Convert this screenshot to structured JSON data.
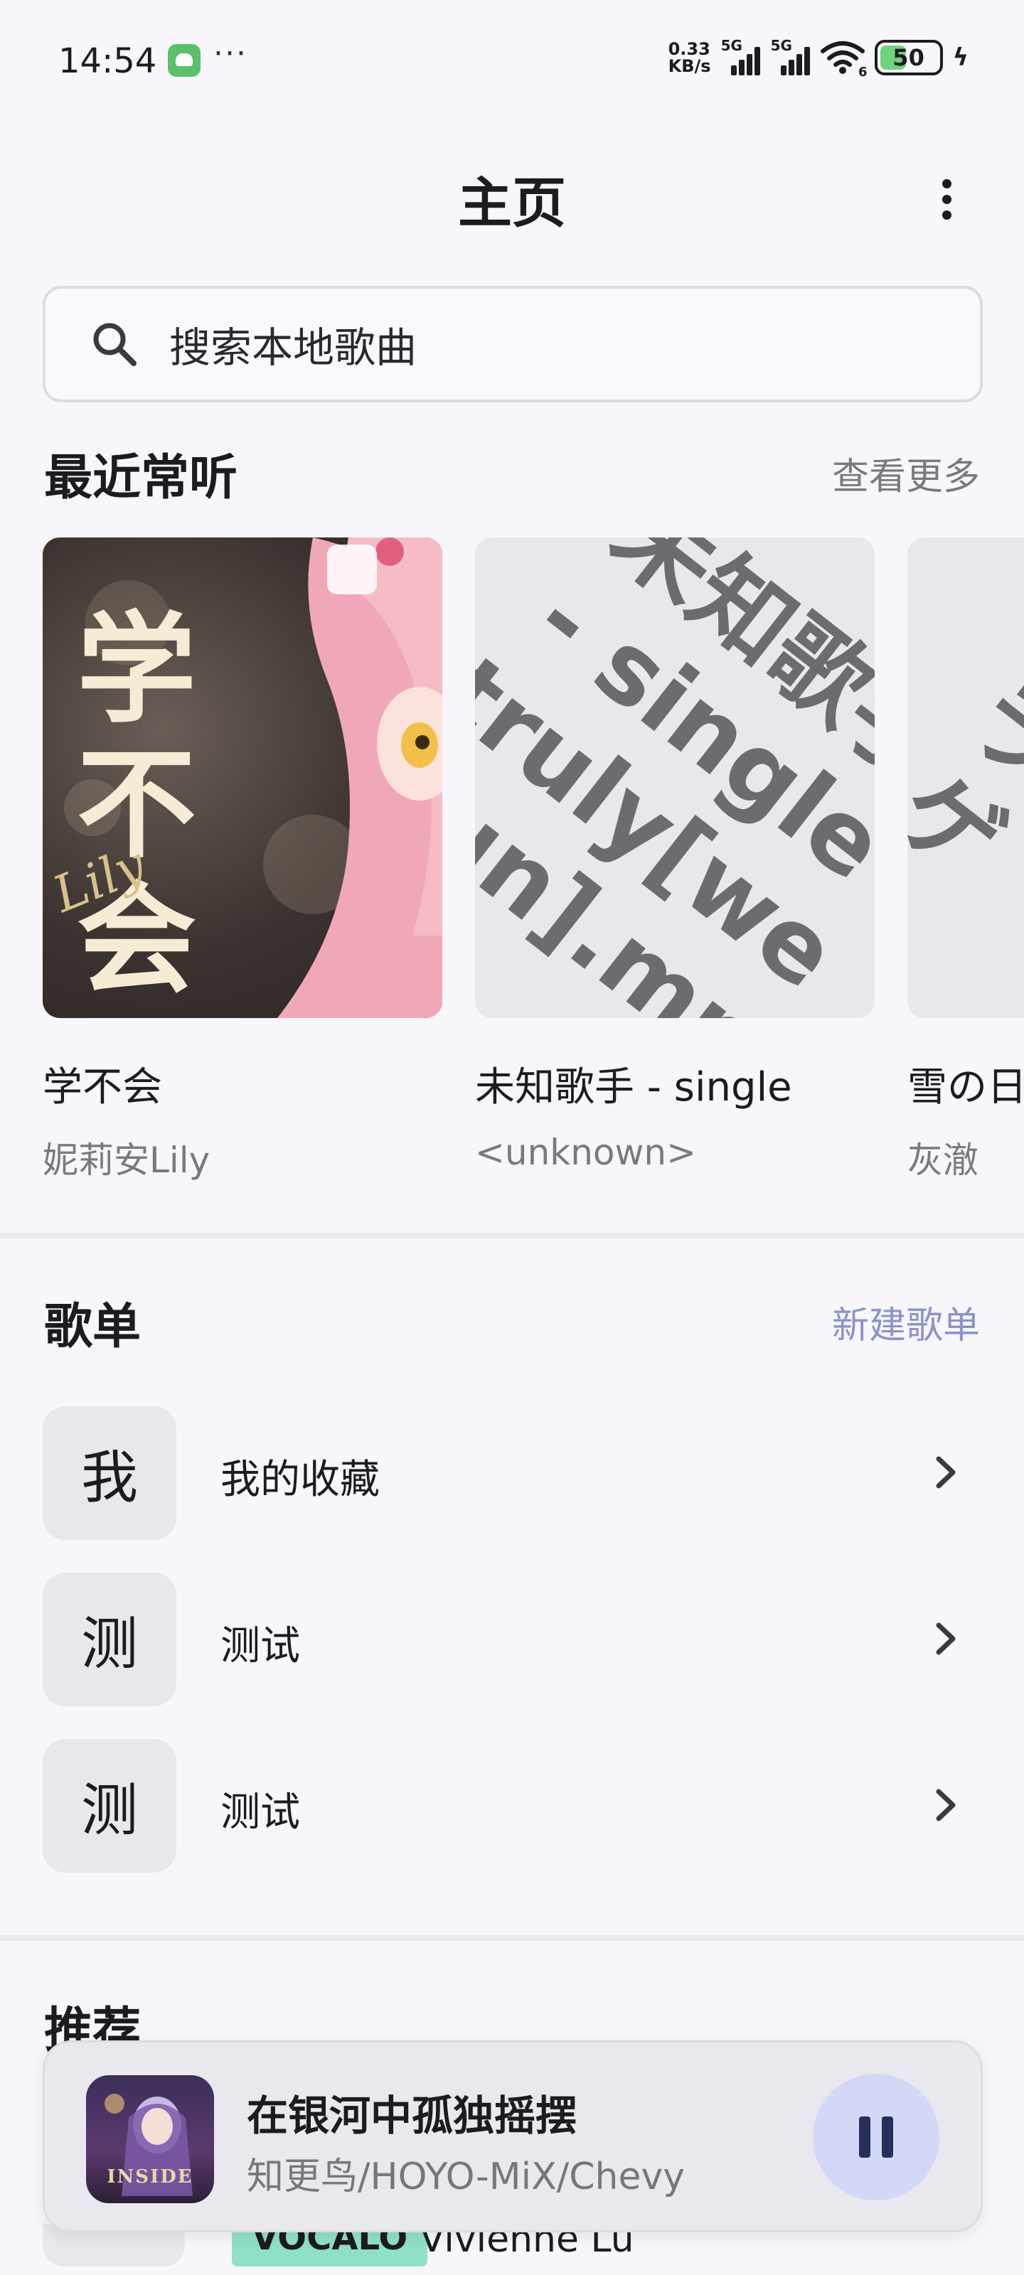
{
  "status_bar": {
    "time": "14:54",
    "net_speed_value": "0.33",
    "net_speed_unit": "KB/s",
    "sim1_label": "5G",
    "sim2_label": "5G",
    "wifi_label": "6",
    "battery": "50",
    "battery_level": 0.5,
    "overflow": "···"
  },
  "header": {
    "title": "主页"
  },
  "search": {
    "placeholder": "搜索本地歌曲"
  },
  "recent": {
    "title": "最近常听",
    "more_label": "查看更多",
    "cards": [
      {
        "title": "学不会",
        "artist": "妮莉安Lily",
        "art_title": "学不会",
        "art_signature": "Lily"
      },
      {
        "title": "未知歌手 - single",
        "artist": "<unknown>",
        "art_text": "未知歌手\n- single\ntruly[we\nyun].mp"
      },
      {
        "title": "雪の日",
        "artist": "灰澈",
        "art_text": "ラ\nゲ"
      }
    ]
  },
  "playlists": {
    "title": "歌单",
    "new_label": "新建歌单",
    "items": [
      {
        "initial": "我",
        "name": "我的收藏"
      },
      {
        "initial": "测",
        "name": "测试"
      },
      {
        "initial": "测",
        "name": "测试"
      }
    ]
  },
  "recommend": {
    "title": "推荐",
    "peek_tag": "VOCALO",
    "peek_text": "Vivienne Lu"
  },
  "now_playing": {
    "title": "在银河中孤独摇摆",
    "artist": "知更鸟/HOYO-MiX/Chevy",
    "cover_text": "INSIDE"
  },
  "colors": {
    "accent": "#8b93c9",
    "pause_bg": "#d4d8f7",
    "pause_icon": "#26305a",
    "battery_fill": "#6fd47e"
  }
}
